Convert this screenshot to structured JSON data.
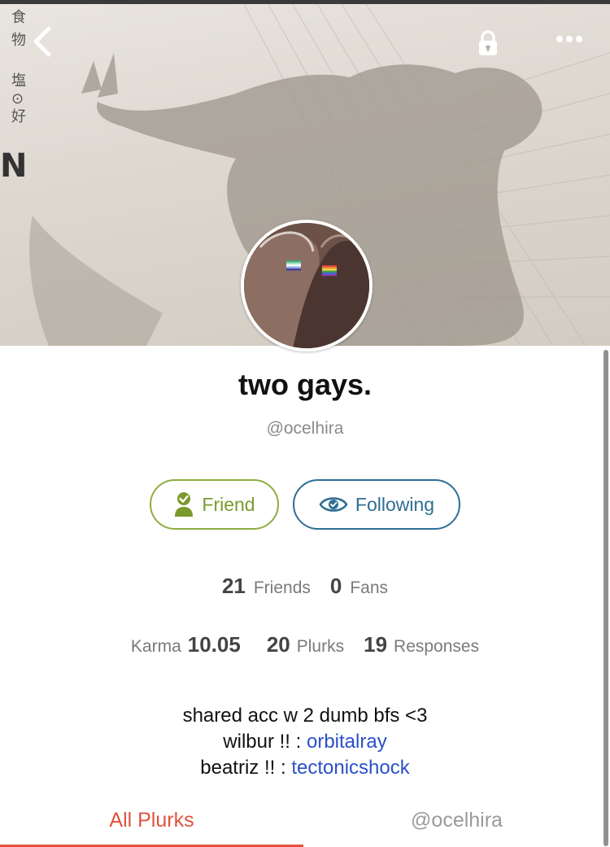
{
  "nav": {
    "back_icon": "chevron-left-icon",
    "lock_icon": "lock-icon",
    "more_icon": "more-icon"
  },
  "cover": {
    "side_text": [
      "食",
      "物",
      "塩",
      "⊙",
      "好",
      "N"
    ]
  },
  "profile": {
    "display_name": "two gays.",
    "username": "@ocelhira"
  },
  "actions": {
    "friend_label": "Friend",
    "following_label": "Following"
  },
  "stats": {
    "friends_count": "21",
    "friends_label": "Friends",
    "fans_count": "0",
    "fans_label": "Fans",
    "karma_label": "Karma",
    "karma_value": "10.05",
    "plurks_count": "20",
    "plurks_label": "Plurks",
    "responses_count": "19",
    "responses_label": "Responses"
  },
  "bio": {
    "line1": "shared acc w 2 dumb bfs <3",
    "line2_prefix": "wilbur !! : ",
    "line2_link": "orbitalray",
    "line3_prefix": "beatriz !! : ",
    "line3_link": "tectonicshock"
  },
  "tabs": {
    "all_plurks": "All Plurks",
    "user_tab": "@ocelhira"
  },
  "colors": {
    "friend_green": "#7a9a2e",
    "following_blue": "#2f6e94",
    "link_blue": "#2b50c8",
    "active_tab_red": "#e0533f"
  }
}
